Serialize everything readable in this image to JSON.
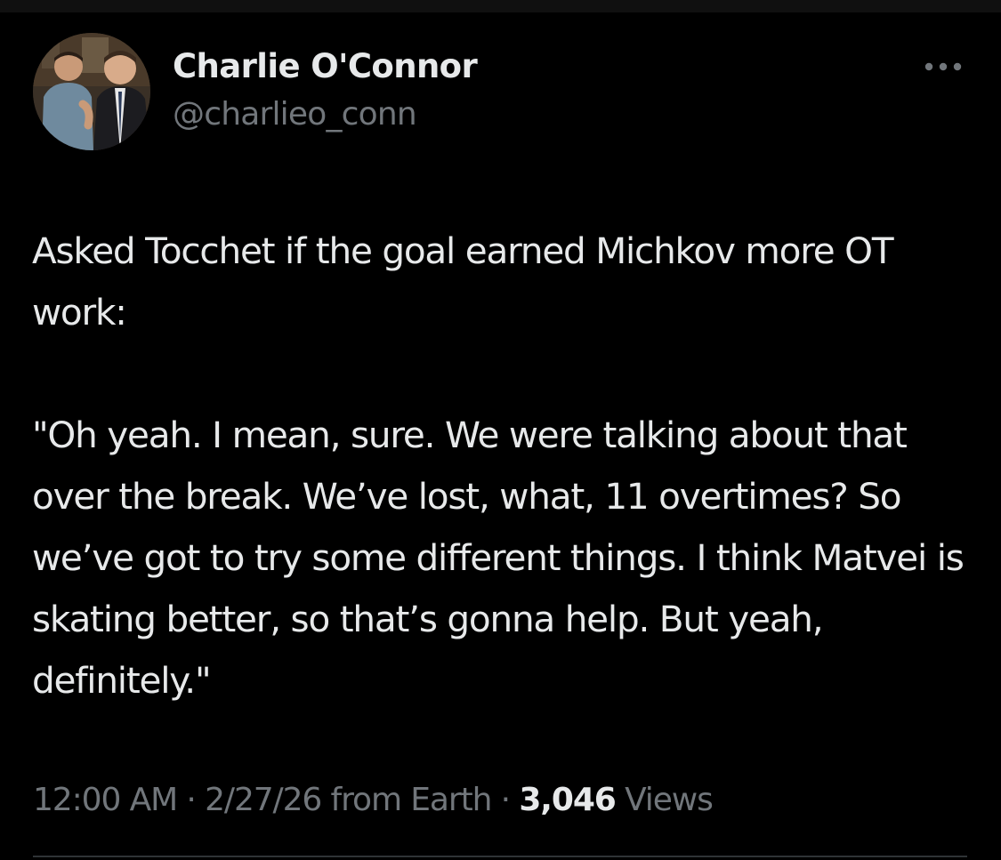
{
  "author": {
    "display_name": "Charlie O'Connor",
    "handle": "@charlieo_conn",
    "avatar": "profile-photo"
  },
  "tweet": {
    "paragraphs": [
      "Asked Tocchet if the goal earned Michkov more OT work:",
      "\"Oh yeah. I mean, sure. We were talking about that over the break. We’ve lost, what, 11 overtimes? So we’ve got to try some different things. I think Matvei is skating better, so that’s gonna help. But yeah, definitely.\""
    ]
  },
  "meta": {
    "time": "12:00 AM",
    "separator": "·",
    "date": "2/27/26",
    "source": "from Earth",
    "views_count": "3,046",
    "views_label": "Views"
  },
  "icons": {
    "more": "more-horizontal-icon"
  },
  "colors": {
    "background": "#000000",
    "primary_text": "#e7e9ea",
    "secondary_text": "#71767b"
  }
}
